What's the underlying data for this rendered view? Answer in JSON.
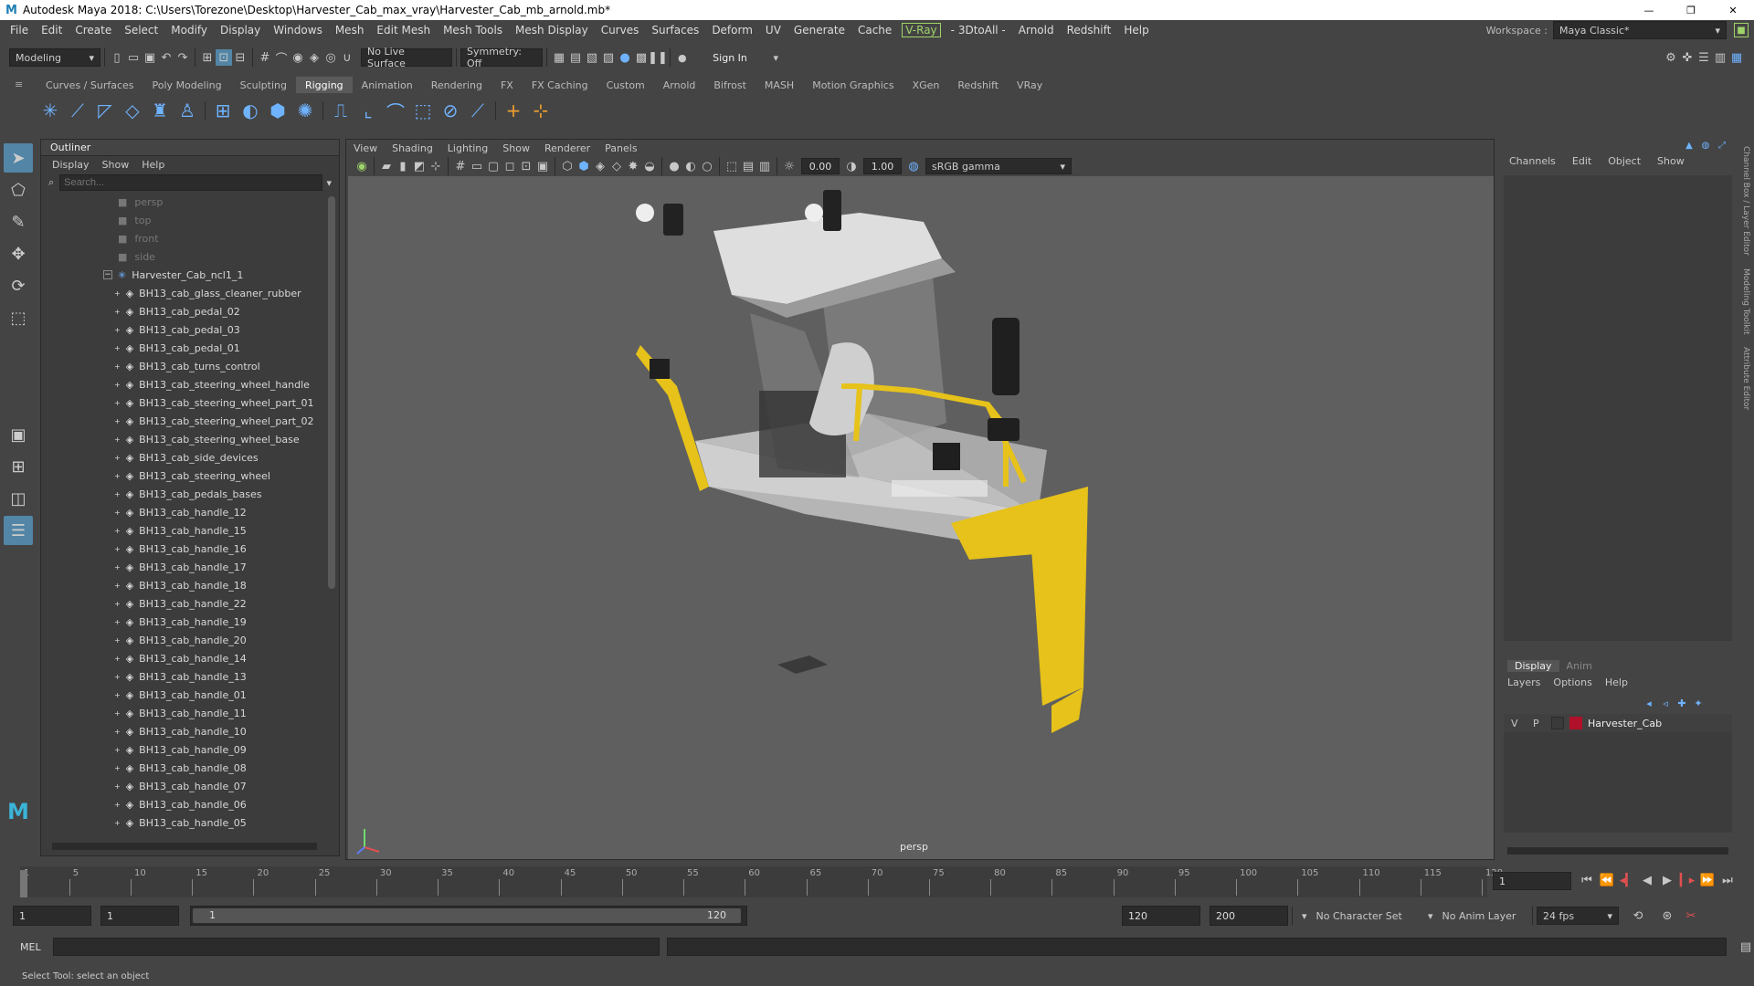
{
  "window": {
    "title": "Autodesk Maya 2018: C:\\Users\\Torezone\\Desktop\\Harvester_Cab_max_vray\\Harvester_Cab_mb_arnold.mb*",
    "minimize": "—",
    "restore": "❐",
    "close": "✕"
  },
  "menus": [
    "File",
    "Edit",
    "Create",
    "Select",
    "Modify",
    "Display",
    "Windows",
    "Mesh",
    "Edit Mesh",
    "Mesh Tools",
    "Mesh Display",
    "Curves",
    "Surfaces",
    "Deform",
    "UV",
    "Generate",
    "Cache",
    "V-Ray",
    "- 3DtoAll -",
    "Arnold",
    "Redshift",
    "Help"
  ],
  "workspace": {
    "label": "Workspace :",
    "value": "Maya Classic*"
  },
  "statusline": {
    "mode": "Modeling",
    "live_surface": "No Live Surface",
    "symmetry": "Symmetry: Off",
    "sign_in": "Sign In"
  },
  "shelf_tabs": [
    "Curves / Surfaces",
    "Poly Modeling",
    "Sculpting",
    "Rigging",
    "Animation",
    "Rendering",
    "FX",
    "FX Caching",
    "Custom",
    "Arnold",
    "Bifrost",
    "MASH",
    "Motion Graphics",
    "XGen",
    "Redshift",
    "VRay"
  ],
  "shelf_active": "Rigging",
  "outliner": {
    "title": "Outliner",
    "menu": [
      "Display",
      "Show",
      "Help"
    ],
    "search_placeholder": "Search...",
    "cameras": [
      "persp",
      "top",
      "front",
      "side"
    ],
    "group": "Harvester_Cab_ncl1_1",
    "children": [
      "BH13_cab_glass_cleaner_rubber",
      "BH13_cab_pedal_02",
      "BH13_cab_pedal_03",
      "BH13_cab_pedal_01",
      "BH13_cab_turns_control",
      "BH13_cab_steering_wheel_handle",
      "BH13_cab_steering_wheel_part_01",
      "BH13_cab_steering_wheel_part_02",
      "BH13_cab_steering_wheel_base",
      "BH13_cab_side_devices",
      "BH13_cab_steering_wheel",
      "BH13_cab_pedals_bases",
      "BH13_cab_handle_12",
      "BH13_cab_handle_15",
      "BH13_cab_handle_16",
      "BH13_cab_handle_17",
      "BH13_cab_handle_18",
      "BH13_cab_handle_22",
      "BH13_cab_handle_19",
      "BH13_cab_handle_20",
      "BH13_cab_handle_14",
      "BH13_cab_handle_13",
      "BH13_cab_handle_01",
      "BH13_cab_handle_11",
      "BH13_cab_handle_10",
      "BH13_cab_handle_09",
      "BH13_cab_handle_08",
      "BH13_cab_handle_07",
      "BH13_cab_handle_06",
      "BH13_cab_handle_05"
    ]
  },
  "viewport": {
    "menu": [
      "View",
      "Shading",
      "Lighting",
      "Show",
      "Renderer",
      "Panels"
    ],
    "val1": "0.00",
    "val2": "1.00",
    "colorspace": "sRGB gamma",
    "camera_label": "persp"
  },
  "channelbox": {
    "menu": [
      "Channels",
      "Edit",
      "Object",
      "Show"
    ],
    "side_tabs": [
      "Channel Box / Layer Editor",
      "Modeling Toolkit",
      "Attribute Editor"
    ]
  },
  "layers": {
    "tabs": [
      "Display",
      "Anim"
    ],
    "menu": [
      "Layers",
      "Options",
      "Help"
    ],
    "layer": {
      "v": "V",
      "p": "P",
      "name": "Harvester_Cab",
      "color": "#b0102a"
    }
  },
  "timeline": {
    "ticks": [
      "1",
      "5",
      "10",
      "15",
      "20",
      "25",
      "30",
      "35",
      "40",
      "45",
      "50",
      "55",
      "60",
      "65",
      "70",
      "75",
      "80",
      "85",
      "90",
      "95",
      "100",
      "105",
      "110",
      "115",
      "120"
    ],
    "current": "1"
  },
  "range": {
    "start": "1",
    "playback_start": "1",
    "slider_start": "1",
    "slider_end": "120",
    "playback_end": "120",
    "end": "200",
    "character_set": "No Character Set",
    "anim_layer": "No Anim Layer",
    "fps": "24 fps"
  },
  "cmd": {
    "label": "MEL"
  },
  "help": {
    "text": "Select Tool: select an object"
  }
}
